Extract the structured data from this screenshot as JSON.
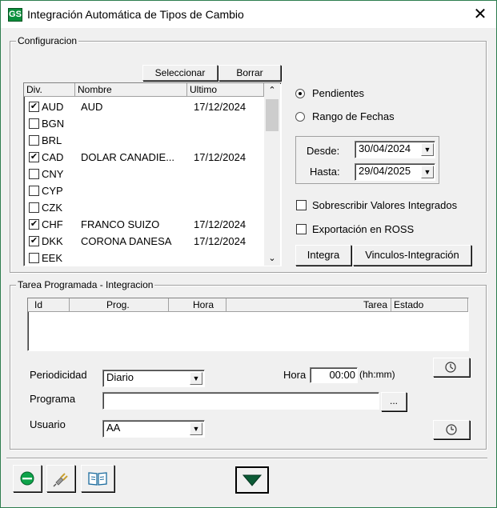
{
  "window": {
    "title": "Integración Automática de Tipos de Cambio",
    "close_glyph": "✕",
    "app_icon_text": "GS"
  },
  "config": {
    "legend": "Configuracion",
    "seleccionar_label": "Seleccionar",
    "borrar_label": "Borrar",
    "columns": [
      "Div.",
      "Nombre",
      "Ultimo"
    ],
    "rows": [
      {
        "div": "AUD",
        "nombre": "AUD",
        "ultimo": "17/12/2024",
        "checked": true
      },
      {
        "div": "BGN",
        "nombre": "",
        "ultimo": "",
        "checked": false
      },
      {
        "div": "BRL",
        "nombre": "",
        "ultimo": "",
        "checked": false
      },
      {
        "div": "CAD",
        "nombre": "DOLAR CANADIE...",
        "ultimo": "17/12/2024",
        "checked": true
      },
      {
        "div": "CNY",
        "nombre": "",
        "ultimo": "",
        "checked": false
      },
      {
        "div": "CYP",
        "nombre": "",
        "ultimo": "",
        "checked": false
      },
      {
        "div": "CZK",
        "nombre": "",
        "ultimo": "",
        "checked": false
      },
      {
        "div": "CHF",
        "nombre": "FRANCO SUIZO",
        "ultimo": "17/12/2024",
        "checked": true
      },
      {
        "div": "DKK",
        "nombre": "CORONA DANESA",
        "ultimo": "17/12/2024",
        "checked": true
      },
      {
        "div": "EEK",
        "nombre": "",
        "ultimo": "",
        "checked": false
      }
    ],
    "pendientes_label": "Pendientes",
    "rango_label": "Rango de Fechas",
    "desde_label": "Desde:",
    "desde_value": "30/04/2024",
    "hasta_label": "Hasta:",
    "hasta_value": "29/04/2025",
    "sobrescribir_label": "Sobrescribir  Valores Integrados",
    "exportacion_label": "Exportación en ROSS",
    "integra_label": "Integra",
    "vinculos_label": "Vinculos-Integración"
  },
  "tarea": {
    "legend": "Tarea Programada - Integracion",
    "columns": [
      "Id",
      "Prog.",
      "Hora",
      "Tarea",
      "Estado"
    ],
    "periodicidad_label": "Periodicidad",
    "periodicidad_value": "Diario",
    "hora_label": "Hora",
    "hora_value": "00:00",
    "hora_unit": "(hh:mm)",
    "programa_label": "Programa",
    "programa_value": "",
    "browse_label": "...",
    "usuario_label": "Usuario",
    "usuario_value": "AA"
  },
  "colors": {
    "accent_green": "#0a8f3c",
    "window_border": "#2e7d4f",
    "down_arrow": "#0b5a35"
  }
}
